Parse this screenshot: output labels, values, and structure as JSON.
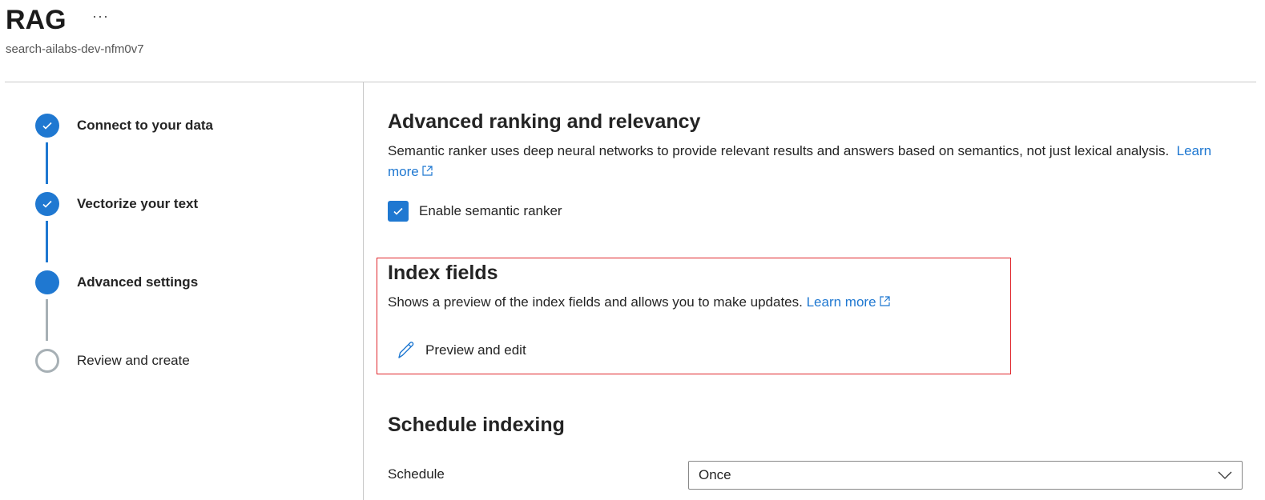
{
  "header": {
    "title": "RAG",
    "more": "···",
    "subtitle": "search-ailabs-dev-nfm0v7"
  },
  "steps": [
    {
      "label": "Connect to your data",
      "status": "completed"
    },
    {
      "label": "Vectorize your text",
      "status": "completed"
    },
    {
      "label": "Advanced settings",
      "status": "current"
    },
    {
      "label": "Review and create",
      "status": "pending"
    }
  ],
  "ranking": {
    "heading": "Advanced ranking and relevancy",
    "description": "Semantic ranker uses deep neural networks to provide relevant results and answers based on semantics, not just lexical analysis.",
    "learn_more": "Learn more",
    "checkbox_label": "Enable semantic ranker",
    "checked": true
  },
  "index_fields": {
    "heading": "Index fields",
    "description": "Shows a preview of the index fields and allows you to make updates.",
    "learn_more": "Learn more",
    "preview_button": "Preview and edit"
  },
  "schedule": {
    "heading": "Schedule indexing",
    "label": "Schedule",
    "value": "Once"
  },
  "colors": {
    "accent": "#1f78d1",
    "highlight": "#e0252b"
  }
}
